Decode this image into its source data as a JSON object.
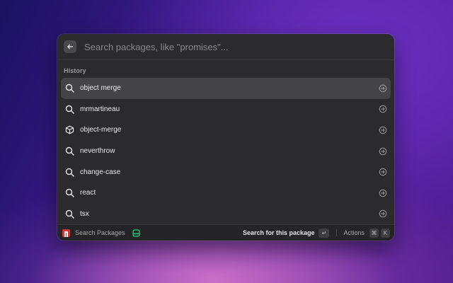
{
  "search": {
    "placeholder": "Search packages, like \"promises\"..."
  },
  "history": {
    "title": "History",
    "items": [
      {
        "label": "object merge",
        "icon": "search-icon",
        "selected": true
      },
      {
        "label": "mrmartineau",
        "icon": "search-icon"
      },
      {
        "label": "object-merge",
        "icon": "package-icon"
      },
      {
        "label": "neverthrow",
        "icon": "search-icon"
      },
      {
        "label": "change-case",
        "icon": "search-icon"
      },
      {
        "label": "react",
        "icon": "search-icon"
      },
      {
        "label": "tsx",
        "icon": "search-icon"
      }
    ]
  },
  "footer": {
    "command_name": "Search Packages",
    "primary_action": "Search for this package",
    "enter_key": "↵",
    "actions_label": "Actions",
    "cmd_key": "⌘",
    "k_key": "K"
  },
  "colors": {
    "npm": "#cb3837",
    "extension_icon": "#2fd08a",
    "panel": "#2b2b2d"
  }
}
